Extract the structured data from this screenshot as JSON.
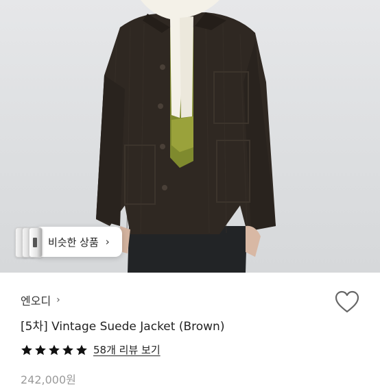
{
  "hero": {
    "image": "product-photo-brown-corduroy-jacket-with-scarf"
  },
  "similar": {
    "label": "비슷한 상품",
    "chevron": "›"
  },
  "product": {
    "brand": "엔오디",
    "brand_chevron": "›",
    "title": "[5차] Vintage Suede Jacket (Brown)",
    "rating_stars": 5,
    "review_link": "58개 리뷰 보기",
    "price": "242,000원"
  },
  "colors": {
    "star": "#111111",
    "heart_outline": "#666666",
    "price": "#9a9a9a"
  },
  "icons": {
    "wishlist": "heart-outline-icon",
    "star": "star-icon",
    "chevron": "chevron-right-icon"
  }
}
